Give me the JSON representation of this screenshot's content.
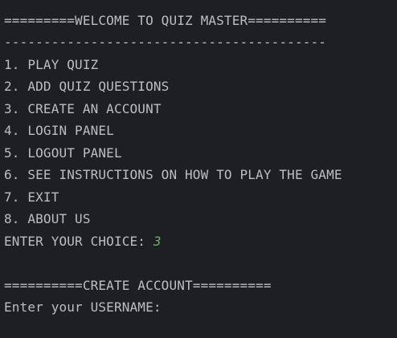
{
  "console": {
    "lines": [
      "=========WELCOME TO QUIZ MASTER==========",
      "-----------------------------------------",
      "1. PLAY QUIZ",
      "2. ADD QUIZ QUESTIONS",
      "3. CREATE AN ACCOUNT",
      "4. LOGIN PANEL",
      "5. LOGOUT PANEL",
      "6. SEE INSTRUCTIONS ON HOW TO PLAY THE GAME",
      "7. EXIT",
      "8. ABOUT US"
    ],
    "choice_prompt": "ENTER YOUR CHOICE: ",
    "choice_value": "3",
    "section_header": "==========CREATE ACCOUNT==========",
    "username_prompt": "Enter your USERNAME:"
  },
  "colors": {
    "background": "#1e1f22",
    "text": "#bcbec4",
    "user_input": "#6aab73"
  }
}
